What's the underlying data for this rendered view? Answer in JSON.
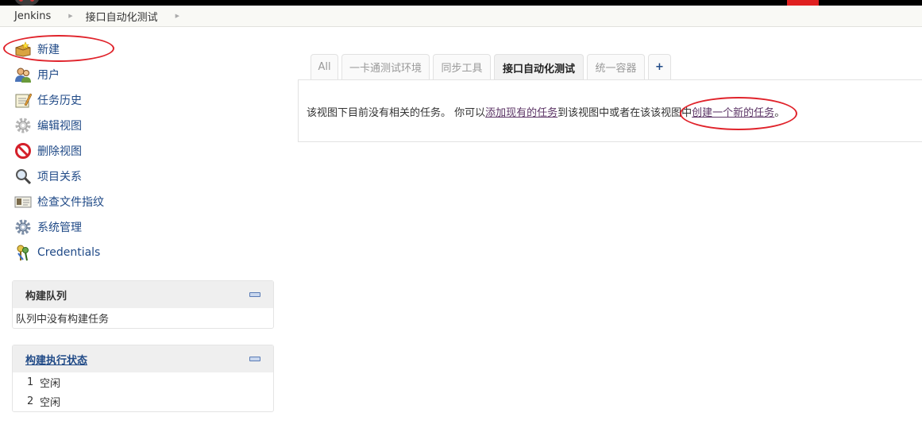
{
  "breadcrumb": {
    "items": [
      {
        "label": "Jenkins"
      },
      {
        "label": "接口自动化测试"
      }
    ]
  },
  "sidebar": {
    "tasks": [
      {
        "label": "新建",
        "icon": "new-item-icon"
      },
      {
        "label": "用户",
        "icon": "users-icon"
      },
      {
        "label": "任务历史",
        "icon": "build-history-icon"
      },
      {
        "label": "编辑视图",
        "icon": "gear-icon"
      },
      {
        "label": "删除视图",
        "icon": "no-entry-icon"
      },
      {
        "label": "项目关系",
        "icon": "search-icon"
      },
      {
        "label": "检查文件指纹",
        "icon": "fingerprint-card-icon"
      },
      {
        "label": "系统管理",
        "icon": "gear-icon"
      },
      {
        "label": "Credentials",
        "icon": "keys-icon"
      }
    ]
  },
  "build_queue": {
    "title": "构建队列",
    "empty_text": "队列中没有构建任务"
  },
  "executors": {
    "title": "构建执行状态",
    "rows": [
      {
        "number": "1",
        "status": "空闲"
      },
      {
        "number": "2",
        "status": "空闲"
      }
    ]
  },
  "tabs": [
    {
      "label": "All"
    },
    {
      "label": "一卡通测试环境"
    },
    {
      "label": "同步工具"
    },
    {
      "label": "接口自动化测试",
      "active": true
    },
    {
      "label": "统一容器"
    },
    {
      "label": "+"
    }
  ],
  "main": {
    "msg_part1": "该视图下目前没有相关的任务。 你可以",
    "link_add": "添加现有的任务",
    "msg_part2": "到该视图中或者在该该视图中",
    "link_create": "创建一个新的任务",
    "msg_end": "。"
  },
  "colors": {
    "link": "#204a87",
    "annotation": "#e0232b",
    "topbar": "#000000"
  }
}
